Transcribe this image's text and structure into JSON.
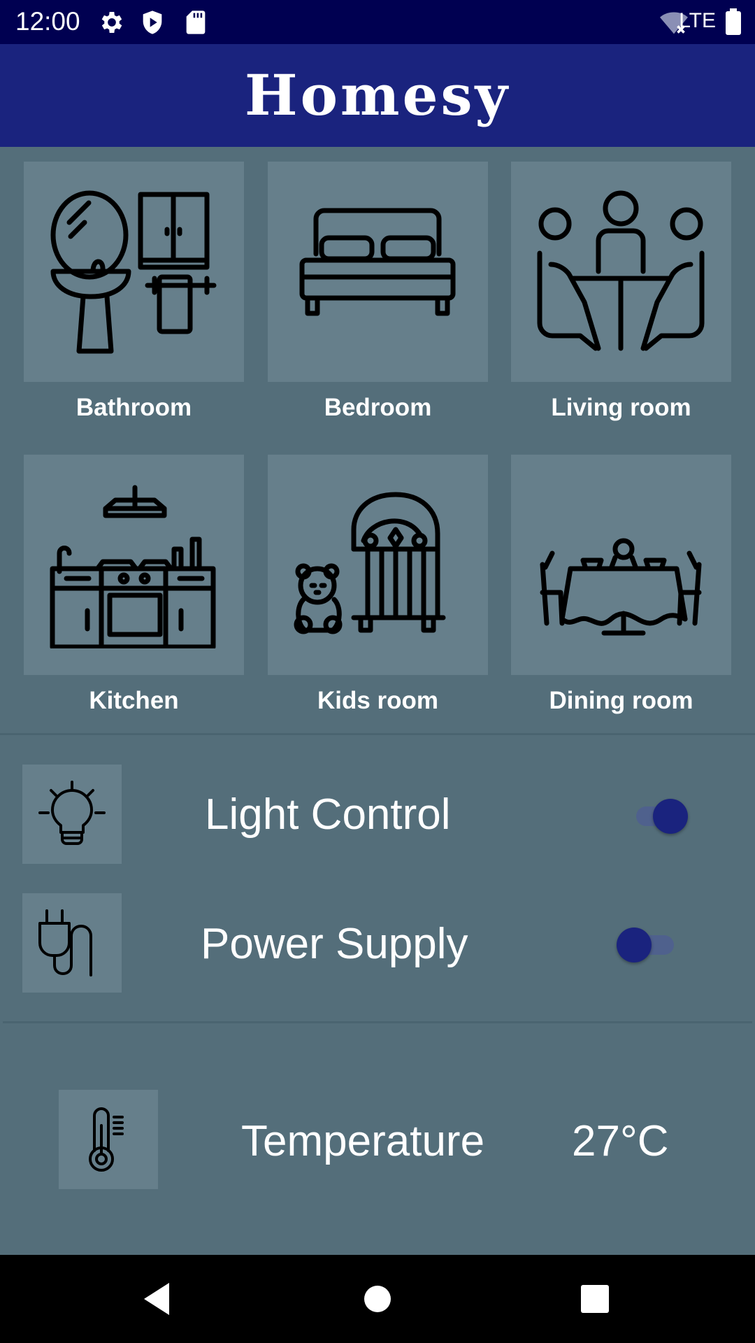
{
  "status_bar": {
    "time": "12:00",
    "network": "LTE",
    "left_icons": [
      "gear-icon",
      "shield-icon",
      "sd-card-icon"
    ],
    "right_icons": [
      "wifi-off-icon",
      "battery-icon"
    ]
  },
  "app_bar": {
    "title": "Homesy",
    "color": "#1a237e"
  },
  "rooms": [
    {
      "label": "Bathroom",
      "icon": "bathroom-icon"
    },
    {
      "label": "Bedroom",
      "icon": "bed-icon"
    },
    {
      "label": "Living room",
      "icon": "living-room-icon"
    },
    {
      "label": "Kitchen",
      "icon": "kitchen-icon"
    },
    {
      "label": "Kids room",
      "icon": "crib-icon"
    },
    {
      "label": "Dining room",
      "icon": "dining-table-icon"
    }
  ],
  "controls": [
    {
      "label": "Light Control",
      "icon": "light-bulb-icon",
      "on": true
    },
    {
      "label": "Power Supply",
      "icon": "power-plug-icon",
      "on": false
    }
  ],
  "temperature": {
    "label": "Temperature",
    "value": "27°C",
    "icon": "thermometer-icon"
  },
  "colors": {
    "background": "#546e7a",
    "tile": "#667f8b",
    "status_bar": "#000051"
  }
}
